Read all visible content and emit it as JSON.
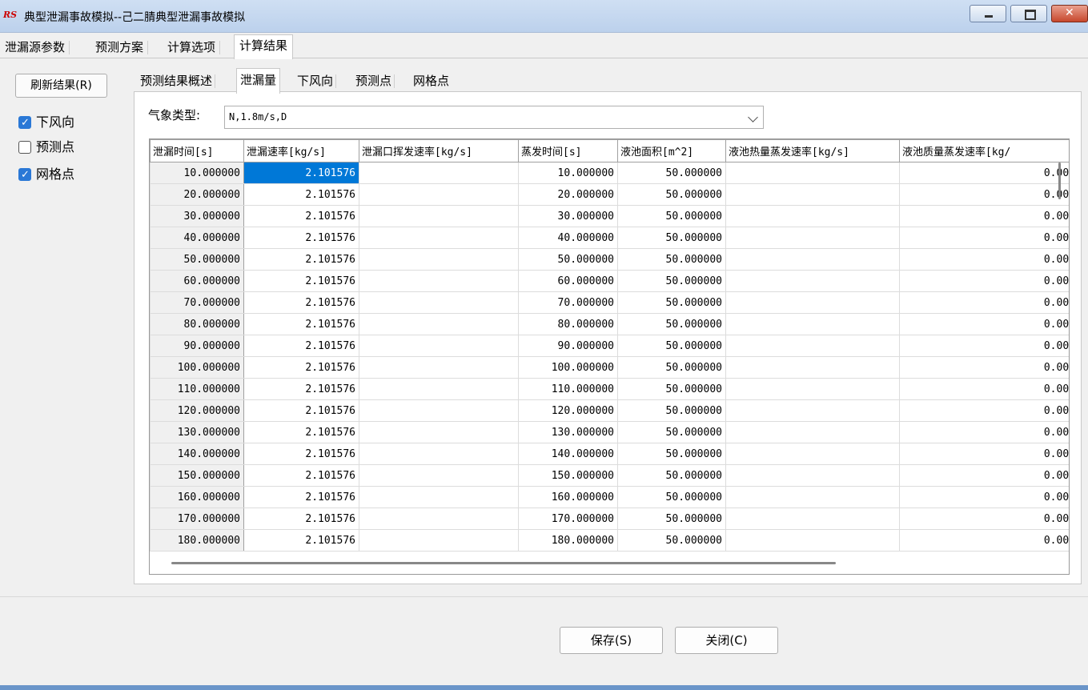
{
  "window": {
    "app_icon": "RS",
    "title": "典型泄漏事故模拟--己二腈典型泄漏事故模拟"
  },
  "top_tabs": [
    "泄漏源参数",
    "预测方案",
    "计算选项",
    "计算结果"
  ],
  "left_panel": {
    "refresh_label": "刷新结果(R)",
    "checks": [
      {
        "label": "下风向",
        "checked": true
      },
      {
        "label": "预测点",
        "checked": false
      },
      {
        "label": "网格点",
        "checked": true
      }
    ]
  },
  "inner_tabs": [
    "预测结果概述",
    "泄漏量",
    "下风向",
    "预测点",
    "网格点"
  ],
  "weather": {
    "label": "气象类型:",
    "value": "N,1.8m/s,D"
  },
  "table": {
    "columns": [
      "泄漏时间[s]",
      "泄漏速率[kg/s]",
      "泄漏口挥发速率[kg/s]",
      "蒸发时间[s]",
      "液池面积[m^2]",
      "液池热量蒸发速率[kg/s]",
      "液池质量蒸发速率[kg/"
    ],
    "rows": [
      [
        "10.000000",
        "2.101576",
        "",
        "10.000000",
        "50.000000",
        "",
        "0.000"
      ],
      [
        "20.000000",
        "2.101576",
        "",
        "20.000000",
        "50.000000",
        "",
        "0.000"
      ],
      [
        "30.000000",
        "2.101576",
        "",
        "30.000000",
        "50.000000",
        "",
        "0.000"
      ],
      [
        "40.000000",
        "2.101576",
        "",
        "40.000000",
        "50.000000",
        "",
        "0.000"
      ],
      [
        "50.000000",
        "2.101576",
        "",
        "50.000000",
        "50.000000",
        "",
        "0.000"
      ],
      [
        "60.000000",
        "2.101576",
        "",
        "60.000000",
        "50.000000",
        "",
        "0.000"
      ],
      [
        "70.000000",
        "2.101576",
        "",
        "70.000000",
        "50.000000",
        "",
        "0.000"
      ],
      [
        "80.000000",
        "2.101576",
        "",
        "80.000000",
        "50.000000",
        "",
        "0.000"
      ],
      [
        "90.000000",
        "2.101576",
        "",
        "90.000000",
        "50.000000",
        "",
        "0.000"
      ],
      [
        "100.000000",
        "2.101576",
        "",
        "100.000000",
        "50.000000",
        "",
        "0.000"
      ],
      [
        "110.000000",
        "2.101576",
        "",
        "110.000000",
        "50.000000",
        "",
        "0.000"
      ],
      [
        "120.000000",
        "2.101576",
        "",
        "120.000000",
        "50.000000",
        "",
        "0.000"
      ],
      [
        "130.000000",
        "2.101576",
        "",
        "130.000000",
        "50.000000",
        "",
        "0.000"
      ],
      [
        "140.000000",
        "2.101576",
        "",
        "140.000000",
        "50.000000",
        "",
        "0.000"
      ],
      [
        "150.000000",
        "2.101576",
        "",
        "150.000000",
        "50.000000",
        "",
        "0.000"
      ],
      [
        "160.000000",
        "2.101576",
        "",
        "160.000000",
        "50.000000",
        "",
        "0.000"
      ],
      [
        "170.000000",
        "2.101576",
        "",
        "170.000000",
        "50.000000",
        "",
        "0.000"
      ],
      [
        "180.000000",
        "2.101576",
        "",
        "180.000000",
        "50.000000",
        "",
        "0.000"
      ]
    ]
  },
  "buttons": {
    "save": "保存(S)",
    "close": "关闭(C)"
  }
}
